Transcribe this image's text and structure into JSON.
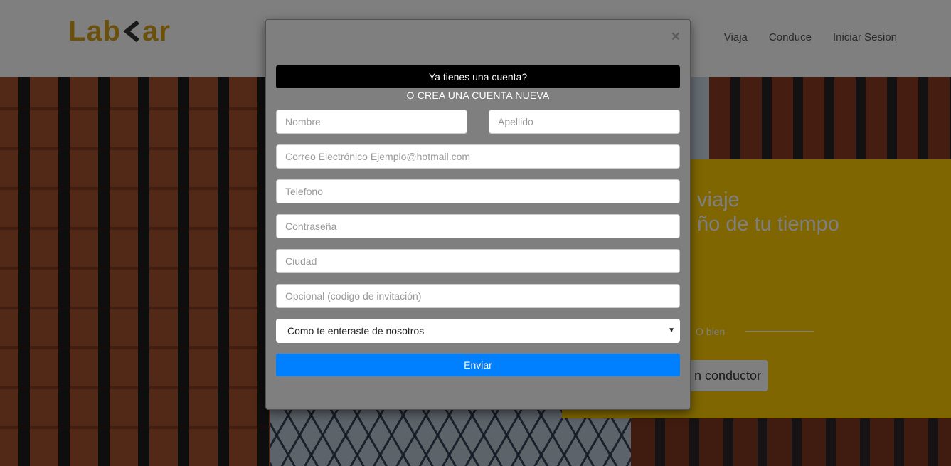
{
  "navbar": {
    "logo": {
      "prefix": "Lab",
      "suffix": "ar",
      "color": "#d4a017"
    },
    "links": [
      "Viaja",
      "Conduce",
      "Iniciar Sesion"
    ]
  },
  "promo": {
    "title_line1": "viaje",
    "title_line2": "ño de tu tiempo",
    "or_label": "O bien",
    "driver_button": "n conductor",
    "color": "#ffcc00"
  },
  "modal": {
    "close_icon": "×",
    "login_bar": "Ya tienes una cuenta?",
    "create_label": "O CREA UNA CUENTA NUEVA",
    "fields": {
      "first_name": "Nombre",
      "last_name": "Apellido",
      "email": "Correo Electrónico Ejemplo@hotmail.com",
      "phone": "Telefono",
      "password": "Contraseña",
      "city": "Ciudad",
      "invite_code": "Opcional (codigo de invitación)"
    },
    "source_select": {
      "selected": "Como te enteraste de nosotros",
      "arrow": "▼"
    },
    "submit": "Enviar",
    "submit_color": "#0080ff"
  }
}
